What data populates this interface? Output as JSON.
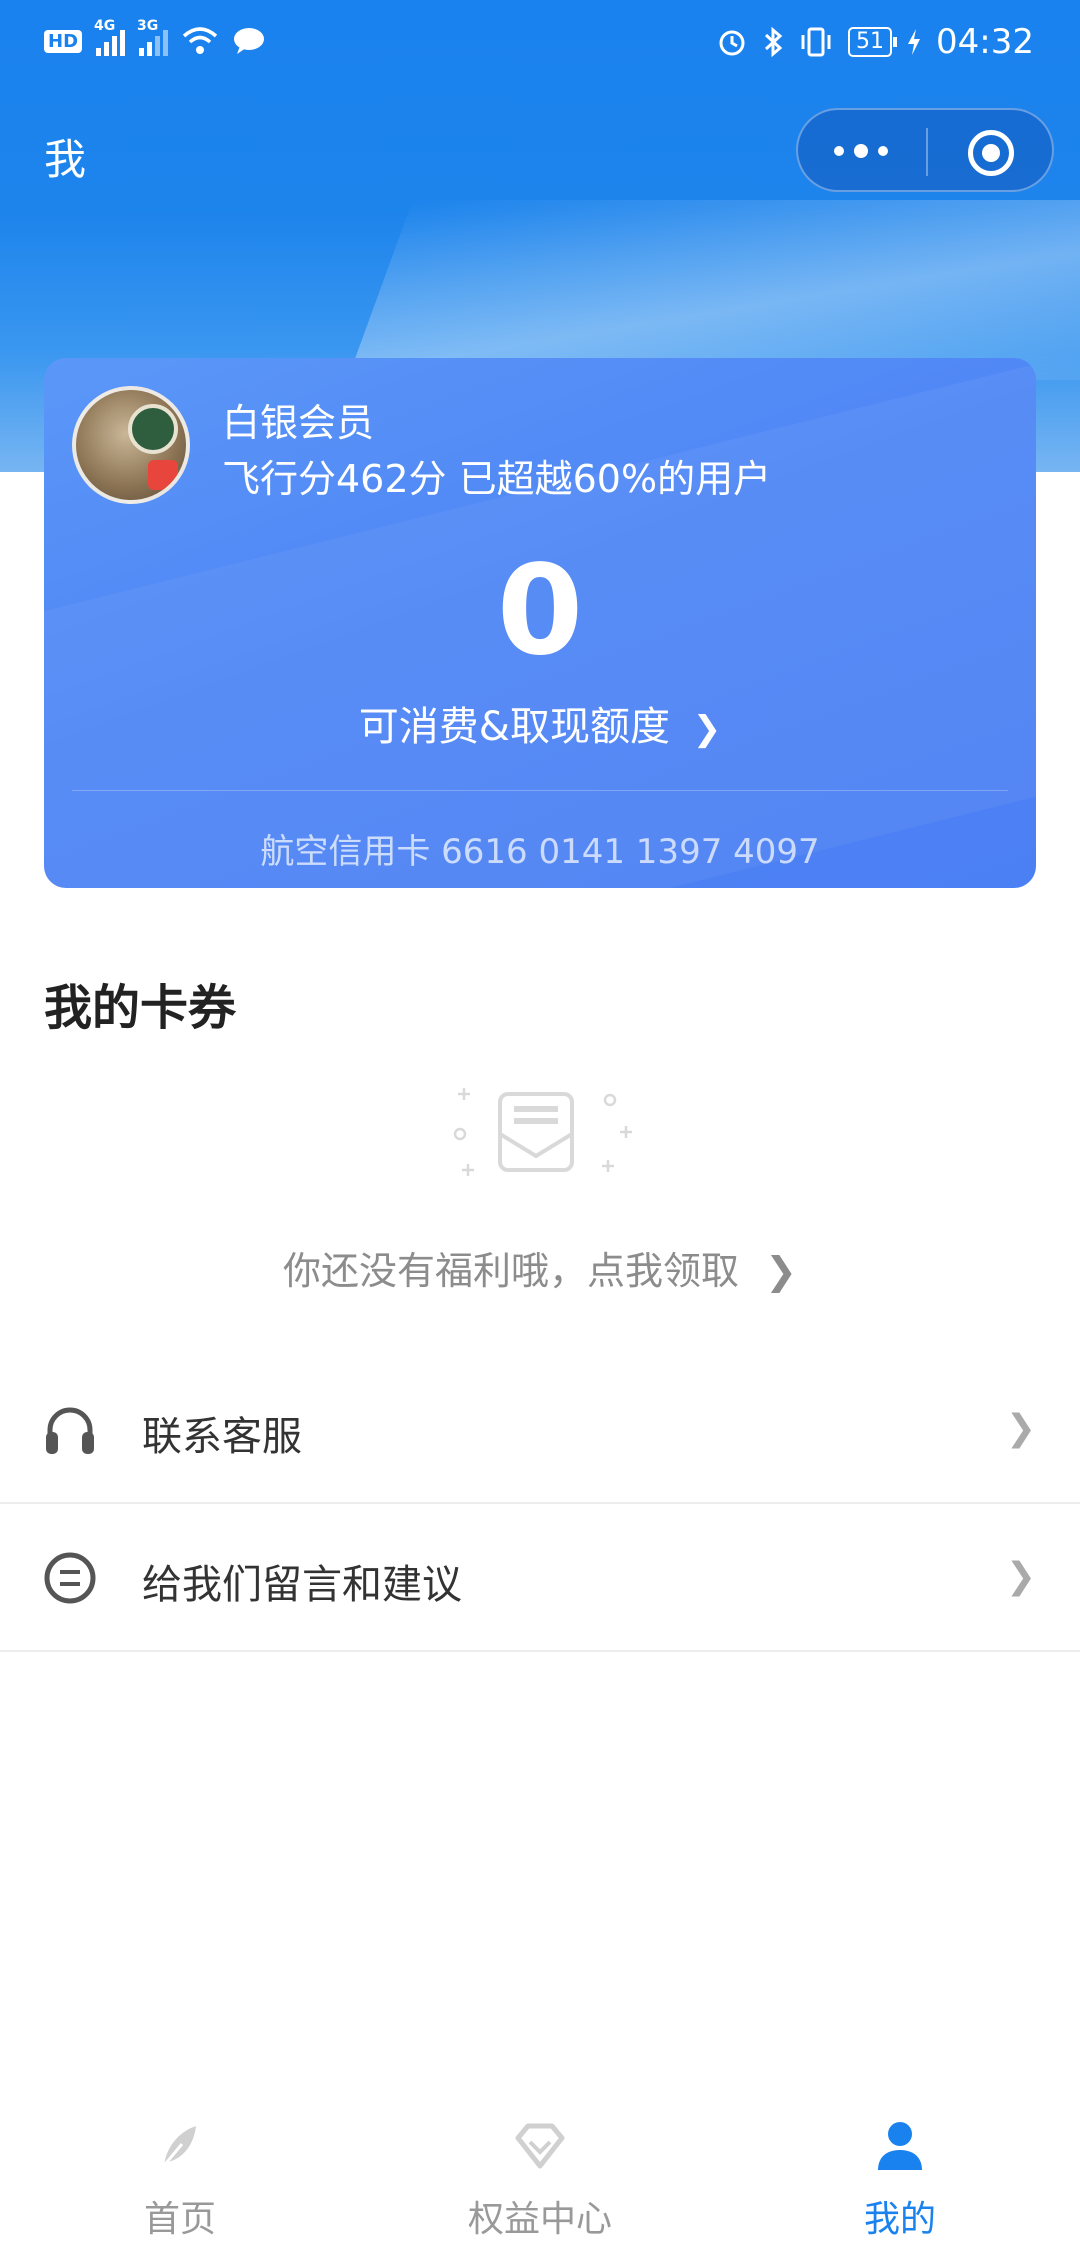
{
  "status_bar": {
    "network_a": "4G",
    "network_b": "3G",
    "hd_label": "HD",
    "battery": "51",
    "time": "04:32"
  },
  "nav": {
    "title": "我"
  },
  "member_card": {
    "level": "白银会员",
    "score_text": "飞行分462分 已超越60%的用户",
    "amount": "0",
    "quota_label": "可消费&取现额度",
    "card_number": "航空信用卡 6616 0141 1397 4097"
  },
  "coupons": {
    "title": "我的卡券",
    "empty_text": "你还没有福利哦，点我领取"
  },
  "menu": [
    {
      "label": "联系客服",
      "icon": "headset-icon"
    },
    {
      "label": "给我们留言和建议",
      "icon": "message-icon"
    }
  ],
  "tabs": [
    {
      "label": "首页",
      "icon": "feather-icon",
      "active": false
    },
    {
      "label": "权益中心",
      "icon": "diamond-icon",
      "active": false
    },
    {
      "label": "我的",
      "icon": "person-icon",
      "active": true
    }
  ],
  "colors": {
    "primary": "#1a82ee",
    "card": "#4f86f5"
  }
}
